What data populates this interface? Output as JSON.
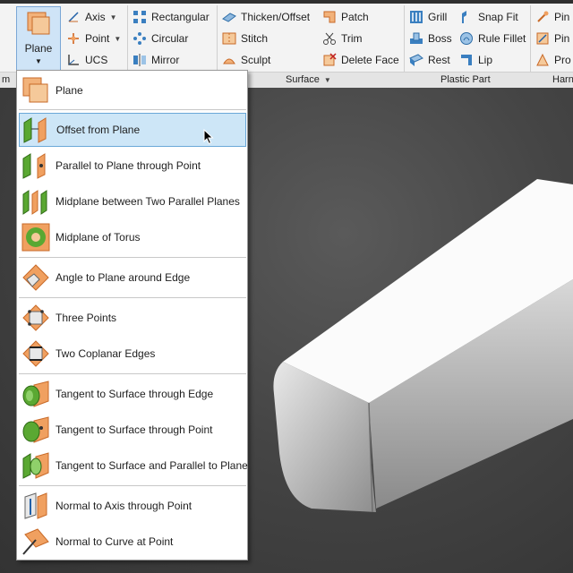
{
  "ribbon": {
    "plane_button": {
      "label": "Plane"
    },
    "column1": [
      {
        "label": "Axis",
        "icon": "axis-icon",
        "has_dropdown": true
      },
      {
        "label": "Point",
        "icon": "point-icon",
        "has_dropdown": true
      },
      {
        "label": "UCS",
        "icon": "ucs-icon",
        "has_dropdown": false
      }
    ],
    "column2": [
      {
        "label": "Rectangular",
        "icon": "rectangular-pattern-icon"
      },
      {
        "label": "Circular",
        "icon": "circular-pattern-icon"
      },
      {
        "label": "Mirror",
        "icon": "mirror-icon"
      }
    ],
    "column3": [
      {
        "label": "Thicken/Offset",
        "icon": "thicken-offset-icon"
      },
      {
        "label": "Stitch",
        "icon": "stitch-icon"
      },
      {
        "label": "Sculpt",
        "icon": "sculpt-icon"
      }
    ],
    "column4": [
      {
        "label": "Patch",
        "icon": "patch-icon"
      },
      {
        "label": "Trim",
        "icon": "trim-icon"
      },
      {
        "label": "Delete Face",
        "icon": "delete-face-icon"
      }
    ],
    "column5": [
      {
        "label": "Grill",
        "icon": "grill-icon"
      },
      {
        "label": "Boss",
        "icon": "boss-icon"
      },
      {
        "label": "Rest",
        "icon": "rest-icon"
      }
    ],
    "column6": [
      {
        "label": "Snap Fit",
        "icon": "snap-fit-icon"
      },
      {
        "label": "Rule Fillet",
        "icon": "rule-fillet-icon"
      },
      {
        "label": "Lip",
        "icon": "lip-icon"
      }
    ],
    "column7": [
      {
        "label": "Pin",
        "icon": "pin-icon"
      },
      {
        "label": "Pin",
        "icon": "pin-icon"
      },
      {
        "label": "Pro",
        "icon": "pro-icon"
      }
    ],
    "panels": {
      "left_fragment": "m",
      "surface": "Surface",
      "plastic_part": "Plastic Part",
      "harness_fragment": "Harn"
    }
  },
  "plane_menu": {
    "highlighted_index": 1,
    "items": [
      {
        "label": "Plane",
        "icon": "plane-icon"
      },
      {
        "label": "Offset from Plane",
        "icon": "offset-plane-icon"
      },
      {
        "label": "Parallel to Plane through Point",
        "icon": "parallel-plane-point-icon"
      },
      {
        "label": "Midplane between Two Parallel Planes",
        "icon": "midplane-icon"
      },
      {
        "label": "Midplane of Torus",
        "icon": "torus-midplane-icon"
      },
      {
        "label": "Angle to Plane around Edge",
        "icon": "angle-plane-edge-icon"
      },
      {
        "label": "Three Points",
        "icon": "three-points-icon"
      },
      {
        "label": "Two Coplanar Edges",
        "icon": "coplanar-edges-icon"
      },
      {
        "label": "Tangent to Surface through Edge",
        "icon": "tangent-edge-icon"
      },
      {
        "label": "Tangent to Surface through Point",
        "icon": "tangent-point-icon"
      },
      {
        "label": "Tangent to Surface and Parallel to Plane",
        "icon": "tangent-parallel-icon"
      },
      {
        "label": "Normal to Axis through Point",
        "icon": "normal-axis-icon"
      },
      {
        "label": "Normal to Curve at Point",
        "icon": "normal-curve-icon"
      }
    ]
  },
  "colors": {
    "accent_orange": "#f0a060",
    "accent_green": "#5aa832",
    "highlight": "#cde6f7",
    "ribbon_bg": "#f3f3f3"
  }
}
